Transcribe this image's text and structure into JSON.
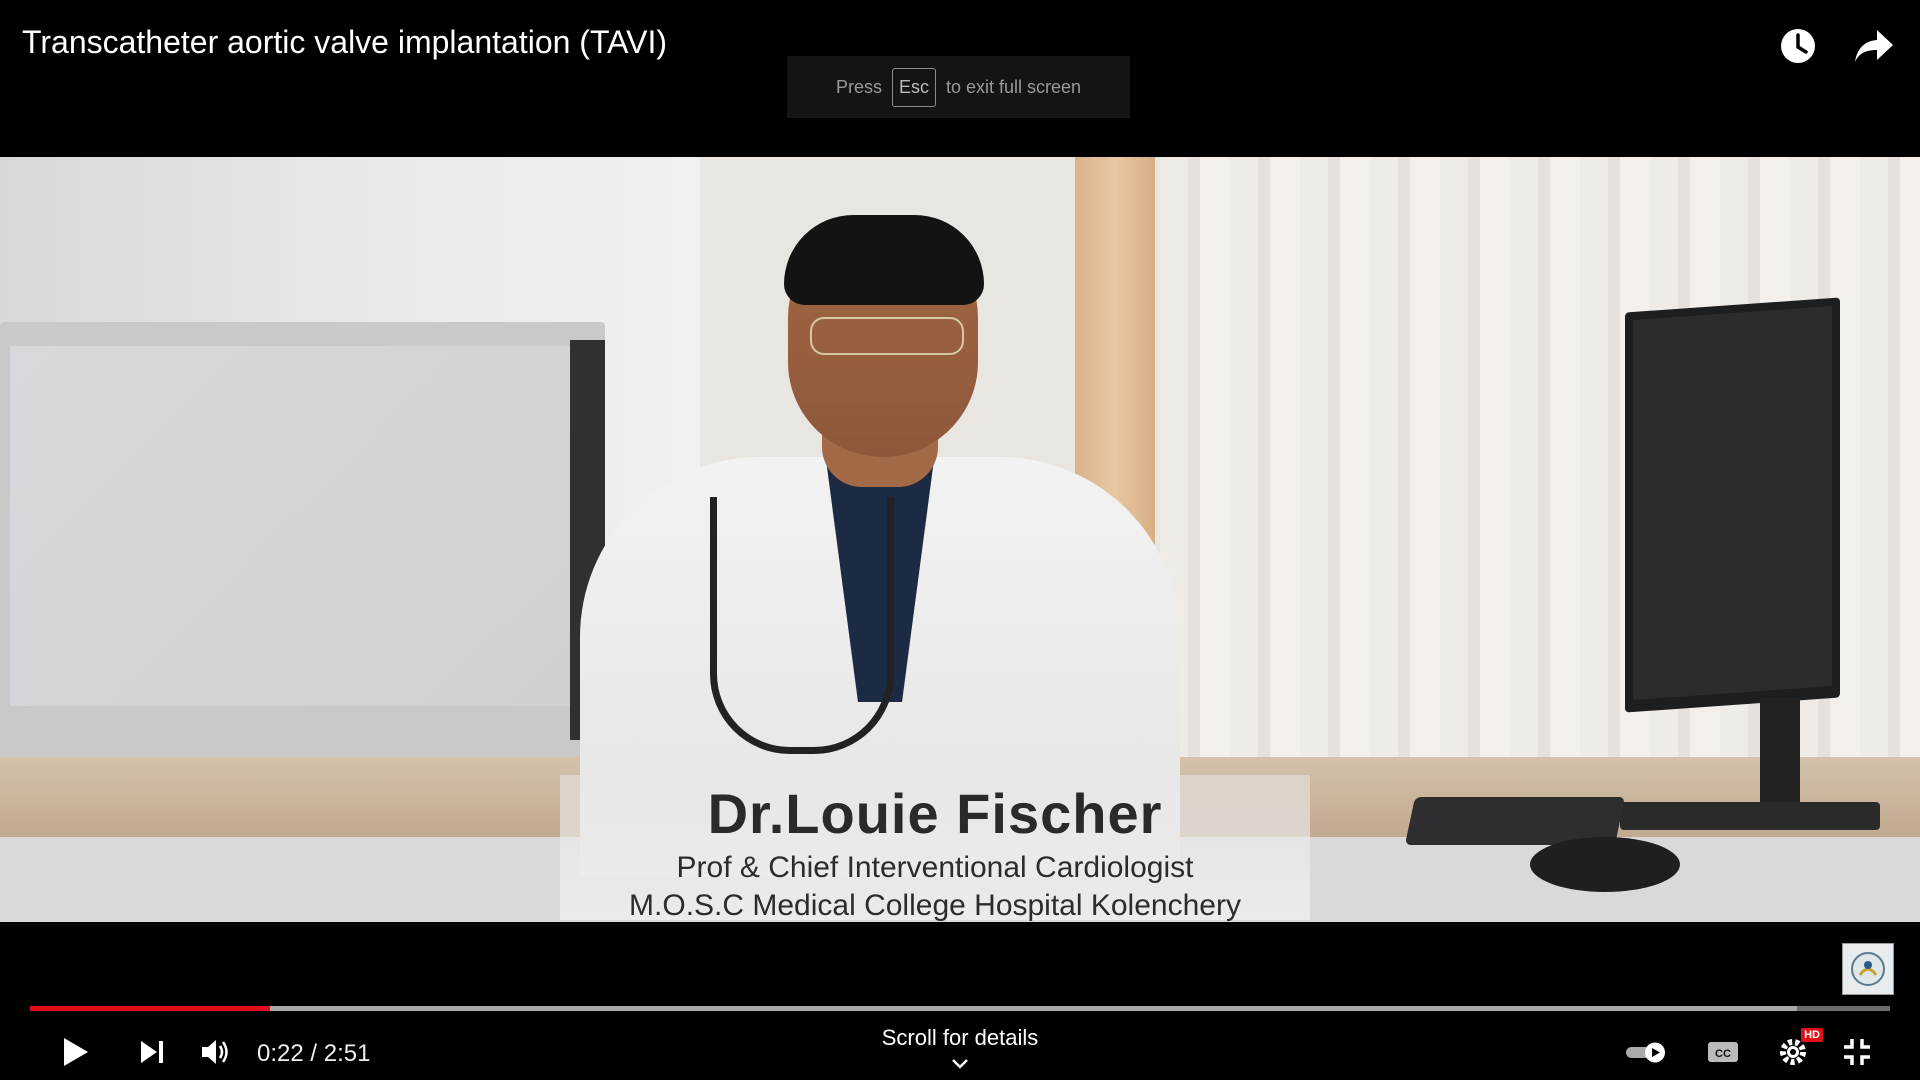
{
  "header": {
    "title": "Transcatheter aortic valve implantation (TAVI)",
    "watch_later_icon": "clock-icon",
    "share_icon": "share-arrow-icon"
  },
  "fullscreen_hint": {
    "press": "Press",
    "key": "Esc",
    "message": "to exit full screen"
  },
  "video": {
    "lower_third": {
      "name": "Dr.Louie Fischer",
      "role": "Prof & Chief Interventional Cardiologist",
      "organization": "M.O.S.C Medical College Hospital Kolenchery"
    }
  },
  "player": {
    "progress": {
      "played_fraction": 0.129,
      "loaded_fraction": 0.95
    },
    "time_display": "0:22 / 2:51",
    "scroll_label": "Scroll for details",
    "hd_badge": "HD",
    "accent_color": "#e10f1a"
  }
}
